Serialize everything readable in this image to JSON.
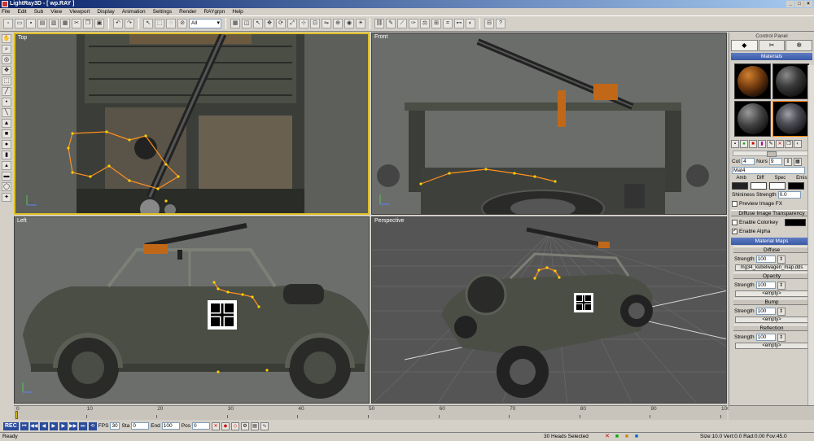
{
  "window": {
    "title": "LightRay3D - [ wp.RAY ]",
    "controls": [
      "_",
      "□",
      "×"
    ]
  },
  "menu": [
    "File",
    "Edit",
    "Sub",
    "View",
    "Viewport",
    "Display",
    "Animation",
    "Settings",
    "Render",
    "RAYgrpn",
    "Help"
  ],
  "toolbar": {
    "selection_mode": "All"
  },
  "viewports": {
    "top": "Top",
    "front": "Front",
    "left": "Left",
    "perspective": "Perspective"
  },
  "panel": {
    "title": "Control Panel",
    "materials_header": "Materials",
    "cut_label": "Cut",
    "cut_value": "4",
    "nursery_label": "Nurs",
    "nursery_value": "9",
    "material_name": "Mat4",
    "color_labels": [
      "Amb",
      "Diff",
      "Spec",
      "Emis"
    ],
    "shininess_label": "Shininess Strength",
    "shininess_value": "0.0",
    "preview_fx_label": "Preview Image FX",
    "diffuse_transparency_label": "Diffuse Image Transparency",
    "enable_colorkey_label": "Enable Colorkey",
    "enable_alpha_label": "Enable Alpha",
    "material_maps_header": "Material Maps",
    "maps": [
      {
        "name": "Diffuse",
        "strength_label": "Strength",
        "strength": "100",
        "file": "mg34_kubelwagen_map.dds"
      },
      {
        "name": "Opacity",
        "strength_label": "Strength",
        "strength": "100",
        "file": "<empty>"
      },
      {
        "name": "Bump",
        "strength_label": "Strength",
        "strength": "100",
        "file": "<empty>"
      },
      {
        "name": "Reflection",
        "strength_label": "Strength",
        "strength": "100",
        "file": "<empty>"
      }
    ]
  },
  "timeline": {
    "ticks": [
      "0",
      "10",
      "20",
      "30",
      "40",
      "50",
      "60",
      "70",
      "80",
      "90",
      "100"
    ]
  },
  "playback": {
    "rec_label": "REC",
    "fps_label": "FPS",
    "fps_value": "30",
    "start_label": "Sta",
    "start_value": "0",
    "end_label": "End",
    "end_value": "100",
    "pos_label": "Pos",
    "pos_value": "0"
  },
  "status": {
    "ready": "Ready",
    "heads": "30 Heads Selected",
    "coords": "Size:10.0  Vert:0.0  Rad:0.00  Fov:45.0"
  },
  "colors": {
    "active_viewport": "#e0c020",
    "section_header": "#3a5aa6",
    "selection_orange": "#ff8800"
  }
}
